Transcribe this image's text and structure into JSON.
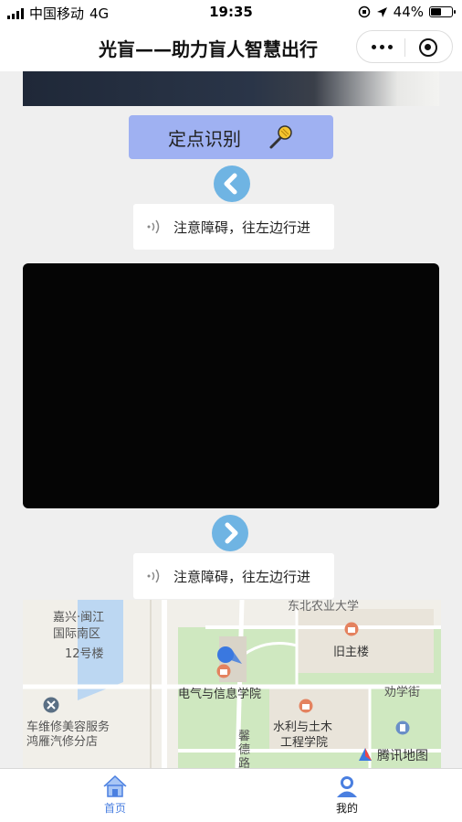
{
  "status_bar": {
    "carrier": "中国移动",
    "network": "4G",
    "time": "19:35",
    "battery": "44%",
    "battery_level": 0.44
  },
  "nav": {
    "title": "光盲——助力盲人智慧出行"
  },
  "recognize_button": {
    "label": "定点识别",
    "icon": "microphone-icon"
  },
  "tips": [
    {
      "text": "注意障碍，往左边行进"
    },
    {
      "text": "注意障碍，往左边行进"
    }
  ],
  "map": {
    "labels": {
      "north_univ": "东北农业大学",
      "jiaxing": "嘉兴·闽江",
      "intl_south": "国际南区",
      "building12": "12号楼",
      "old_main": "旧主楼",
      "ee_school": "电气与信息学院",
      "labor_st": "劝学街",
      "water_civil_1": "水利与土木",
      "water_civil_2": "工程学院",
      "car_repair": "车维修美容服务",
      "honglin": "鸿雁汽修分店",
      "xinde_road": "馨德路",
      "tencent": "腾讯地图"
    },
    "colors": {
      "road": "#ffffff",
      "green": "#cfe8c0",
      "water": "#bcd7f2",
      "poi": "#e4825f",
      "location": "#3a78e0"
    }
  },
  "tabbar": {
    "items": [
      {
        "label": "首页",
        "icon": "home-icon",
        "active": true
      },
      {
        "label": "我的",
        "icon": "user-icon",
        "active": false
      }
    ]
  },
  "colors": {
    "accent": "#4a7fe0",
    "button_bg": "#9fb1f2",
    "arrow_bg": "#6fb4e3"
  }
}
